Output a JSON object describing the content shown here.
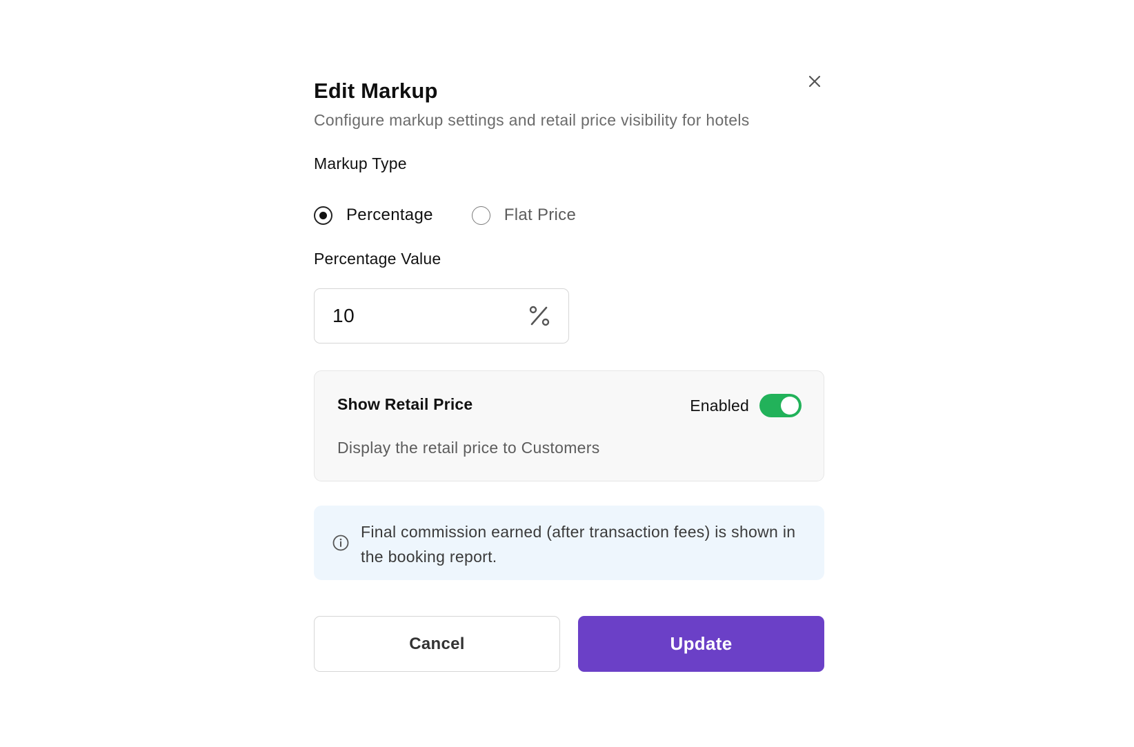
{
  "dialog": {
    "title": "Edit Markup",
    "subtitle": "Configure markup settings and retail price visibility for hotels",
    "close_icon": "close-icon"
  },
  "markup_type": {
    "label": "Markup Type",
    "options": [
      {
        "label": "Percentage",
        "selected": true
      },
      {
        "label": "Flat Price",
        "selected": false
      }
    ]
  },
  "percentage_value": {
    "label": "Percentage Value",
    "value": "10",
    "suffix_icon": "percent-icon"
  },
  "retail_price": {
    "title": "Show Retail Price",
    "description": "Display the retail price to Customers",
    "toggle_label": "Enabled",
    "enabled": true,
    "toggle_color": "#22b25a"
  },
  "info": {
    "icon": "info-icon",
    "text": "Final commission earned (after transaction fees) is shown in the booking report.",
    "background": "#eef6fd"
  },
  "actions": {
    "cancel_label": "Cancel",
    "update_label": "Update",
    "update_color": "#6b40c7"
  }
}
